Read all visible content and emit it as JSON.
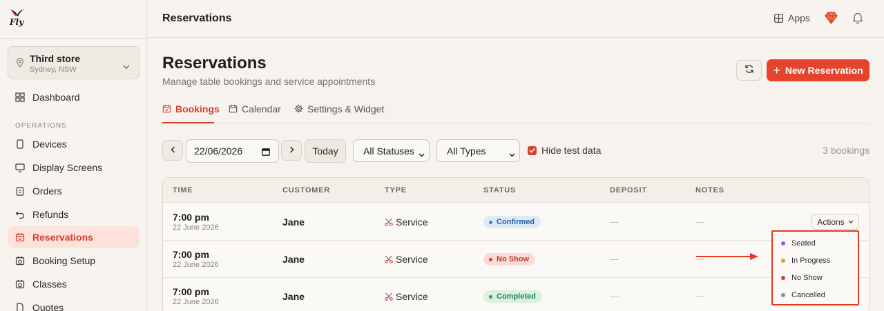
{
  "brand": {
    "logo_text": "Fly"
  },
  "store": {
    "name": "Third store",
    "location": "Sydney, NSW"
  },
  "sidebar": {
    "top_items": [
      {
        "label": "Dashboard"
      }
    ],
    "section_label": "OPERATIONS",
    "items": [
      {
        "label": "Devices"
      },
      {
        "label": "Display Screens"
      },
      {
        "label": "Orders"
      },
      {
        "label": "Refunds"
      },
      {
        "label": "Reservations",
        "active": true
      },
      {
        "label": "Booking Setup"
      },
      {
        "label": "Classes"
      },
      {
        "label": "Quotes"
      }
    ]
  },
  "topbar": {
    "title": "Reservations",
    "apps_label": "Apps"
  },
  "page": {
    "title": "Reservations",
    "subtitle": "Manage table bookings and service appointments",
    "new_button": "New Reservation"
  },
  "tabs": [
    {
      "label": "Bookings",
      "active": true
    },
    {
      "label": "Calendar"
    },
    {
      "label": "Settings & Widget"
    }
  ],
  "filters": {
    "date": "22/06/2026",
    "today_label": "Today",
    "status_select": "All Statuses",
    "type_select": "All Types",
    "hide_test_label": "Hide test data",
    "hide_test_checked": true,
    "count": "3 bookings"
  },
  "table": {
    "columns": [
      "TIME",
      "CUSTOMER",
      "TYPE",
      "STATUS",
      "DEPOSIT",
      "NOTES"
    ],
    "rows": [
      {
        "time": "7:00 pm",
        "date": "22 June 2026",
        "customer": "Jane",
        "type": "Service",
        "status": "Confirmed",
        "deposit": "—",
        "notes": "—",
        "actions": "Actions"
      },
      {
        "time": "7:00 pm",
        "date": "22 June 2026",
        "customer": "Jane",
        "type": "Service",
        "status": "No Show",
        "deposit": "—",
        "notes": "—"
      },
      {
        "time": "7:00 pm",
        "date": "22 June 2026",
        "customer": "Jane",
        "type": "Service",
        "status": "Completed",
        "deposit": "—",
        "notes": "—"
      }
    ]
  },
  "status_menu": {
    "items": [
      {
        "label": "Seated",
        "color": "#8b5cf6"
      },
      {
        "label": "In Progress",
        "color": "#e0a020"
      },
      {
        "label": "No Show",
        "color": "#dc3a2e"
      },
      {
        "label": "Cancelled",
        "color": "#8f8aa0"
      }
    ]
  },
  "colors": {
    "accent": "#e5432b",
    "confirmed_bg": "#dce9f7",
    "confirmed_fg": "#2a5ea8",
    "noshow_bg": "#f9dcd8",
    "noshow_fg": "#c0392b",
    "completed_bg": "#dbf0df",
    "completed_fg": "#23824a"
  }
}
